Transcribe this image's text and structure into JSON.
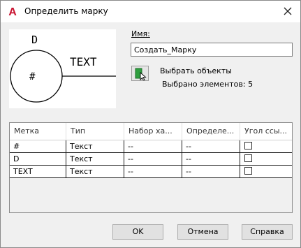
{
  "window": {
    "title": "Определить марку",
    "app_icon_letter": "A",
    "app_icon_color": "#c8102e"
  },
  "preview": {
    "attr_d": "D",
    "attr_hash": "#",
    "attr_text": "TEXT"
  },
  "name": {
    "label": "Имя:",
    "value": "Создать_Марку"
  },
  "selection": {
    "select_label": "Выбрать объекты",
    "count_label": "Выбрано элементов: 5"
  },
  "table": {
    "columns": [
      "Метка",
      "Тип",
      "Набор ха...",
      "Определе...",
      "Угол ссы..."
    ],
    "rows": [
      {
        "label": "#",
        "type": "Текст",
        "set": "--",
        "def": "--",
        "angle_checked": false
      },
      {
        "label": "D",
        "type": "Текст",
        "set": "--",
        "def": "--",
        "angle_checked": false
      },
      {
        "label": "TEXT",
        "type": "Текст",
        "set": "--",
        "def": "--",
        "angle_checked": false
      }
    ]
  },
  "buttons": {
    "ok": "OK",
    "cancel": "Отмена",
    "help": "Справка"
  },
  "colors": {
    "select_icon_green": "#2e9e3e"
  }
}
